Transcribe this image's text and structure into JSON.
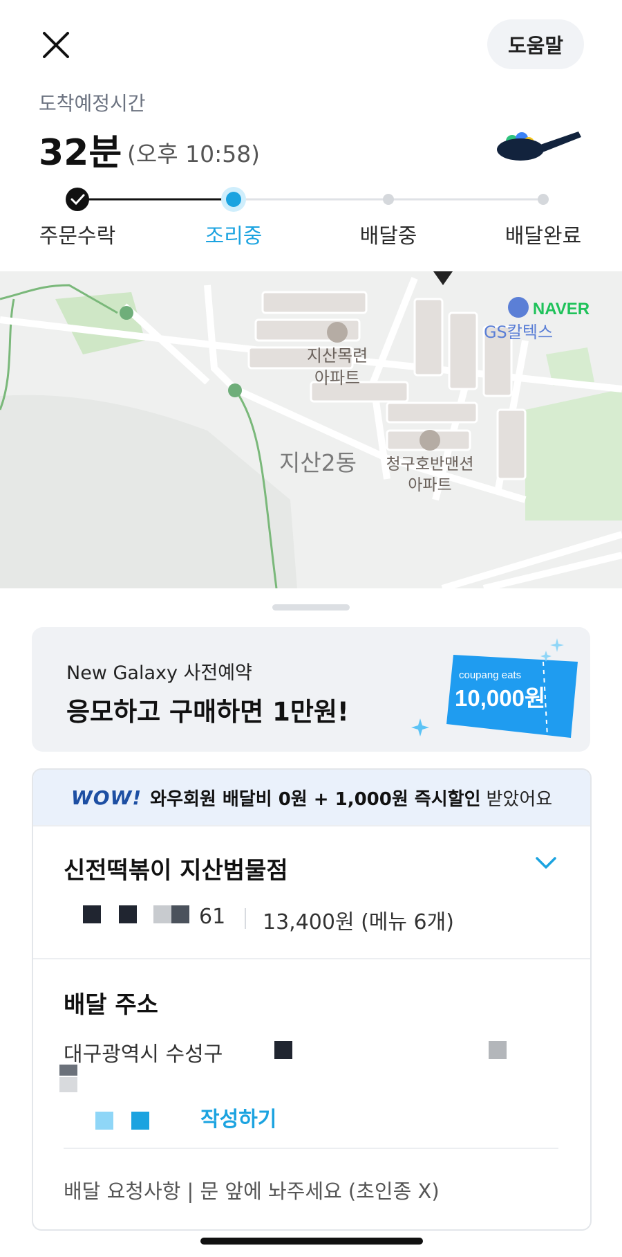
{
  "header": {
    "help_label": "도움말",
    "eta_label": "도착예정시간",
    "eta_minutes": "32분",
    "eta_time": "(오후 10:58)"
  },
  "steps": [
    {
      "label": "주문수락",
      "state": "done"
    },
    {
      "label": "조리중",
      "state": "current"
    },
    {
      "label": "배달중",
      "state": "pending"
    },
    {
      "label": "배달완료",
      "state": "pending"
    }
  ],
  "map": {
    "labels": {
      "apt1_line1": "지산목련",
      "apt1_line2": "아파트",
      "district": "지산2동",
      "apt2_line1": "청구호반맨션",
      "apt2_line2": "아파트",
      "gas_station": "GS칼텍스",
      "provider": "NAVER"
    }
  },
  "promo": {
    "subtitle": "New Galaxy 사전예약",
    "title": "응모하고 구매하면 1만원!",
    "coupon_brand": "coupang eats",
    "coupon_value": "10,000원"
  },
  "order": {
    "wow_logo": "WOW!",
    "wow_strong": "와우회원 배달비 0원 + 1,000원 즉시할인",
    "wow_suffix": "받았어요",
    "store_name": "신전떡볶이 지산범물점",
    "order_number_tail": "61",
    "order_total": "13,400원 (메뉴 6개)"
  },
  "delivery": {
    "title": "배달 주소",
    "address": "대구광역시 수성구",
    "review_link": "작성하기",
    "request": "배달 요청사항 | 문 앞에 놔주세요 (초인종 X)"
  },
  "colors": {
    "accent": "#1ba3e0",
    "progress_done": "#1a1a1a",
    "wow_blue": "#1d4fa3",
    "coupon_blue": "#1f9cf0"
  }
}
